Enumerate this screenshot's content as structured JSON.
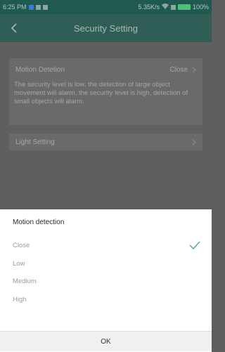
{
  "status_bar": {
    "time": "6:25 PM",
    "network_speed": "5.35K/s",
    "battery": "100%"
  },
  "app_bar": {
    "title": "Security Setting"
  },
  "settings": {
    "motion_detection": {
      "label": "Motion Detetion",
      "value": "Close",
      "description": "The security level is low, the detection of large object movement will alarm, the security level is high, detection of small objects will alarm."
    },
    "light_setting": {
      "label": "Light Setting"
    }
  },
  "sheet": {
    "title": "Motion detection",
    "options": [
      "Close",
      "Low",
      "Medium",
      "High"
    ],
    "selected": "Close",
    "ok_label": "OK"
  },
  "colors": {
    "header": "#2f5e57",
    "status_bar": "#1f5a51",
    "overlay": "#5e5e5e",
    "accent_check": "#4fa79a"
  },
  "icons": {
    "back": "arrow-left-icon",
    "chevron": "chevron-right-icon",
    "check": "check-icon",
    "wifi": "wifi-icon",
    "battery": "battery-icon"
  }
}
